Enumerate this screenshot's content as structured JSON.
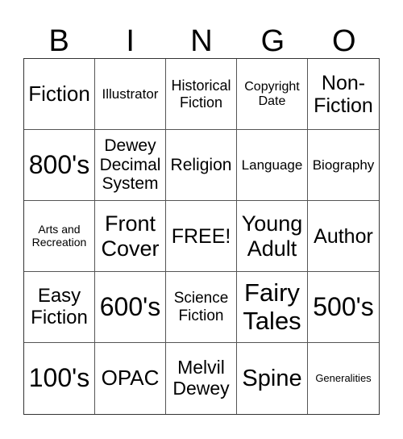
{
  "header": [
    "B",
    "I",
    "N",
    "G",
    "O"
  ],
  "cells": [
    {
      "text": "Fiction",
      "size": 26
    },
    {
      "text": "Illustrator",
      "size": 17
    },
    {
      "text": "Historical Fiction",
      "size": 18
    },
    {
      "text": "Copyright Date",
      "size": 16
    },
    {
      "text": "Non-Fiction",
      "size": 25
    },
    {
      "text": "800's",
      "size": 32
    },
    {
      "text": "Dewey Decimal System",
      "size": 21
    },
    {
      "text": "Religion",
      "size": 21
    },
    {
      "text": "Language",
      "size": 17
    },
    {
      "text": "Biography",
      "size": 17
    },
    {
      "text": "Arts and Recreation",
      "size": 14
    },
    {
      "text": "Front Cover",
      "size": 27
    },
    {
      "text": "FREE!",
      "size": 25
    },
    {
      "text": "Young Adult",
      "size": 27
    },
    {
      "text": "Author",
      "size": 25
    },
    {
      "text": "Easy Fiction",
      "size": 24
    },
    {
      "text": "600's",
      "size": 32
    },
    {
      "text": "Science Fiction",
      "size": 19
    },
    {
      "text": "Fairy Tales",
      "size": 31
    },
    {
      "text": "500's",
      "size": 32
    },
    {
      "text": "100's",
      "size": 32
    },
    {
      "text": "OPAC",
      "size": 26
    },
    {
      "text": "Melvil Dewey",
      "size": 23
    },
    {
      "text": "Spine",
      "size": 29
    },
    {
      "text": "Generalities",
      "size": 13
    }
  ]
}
